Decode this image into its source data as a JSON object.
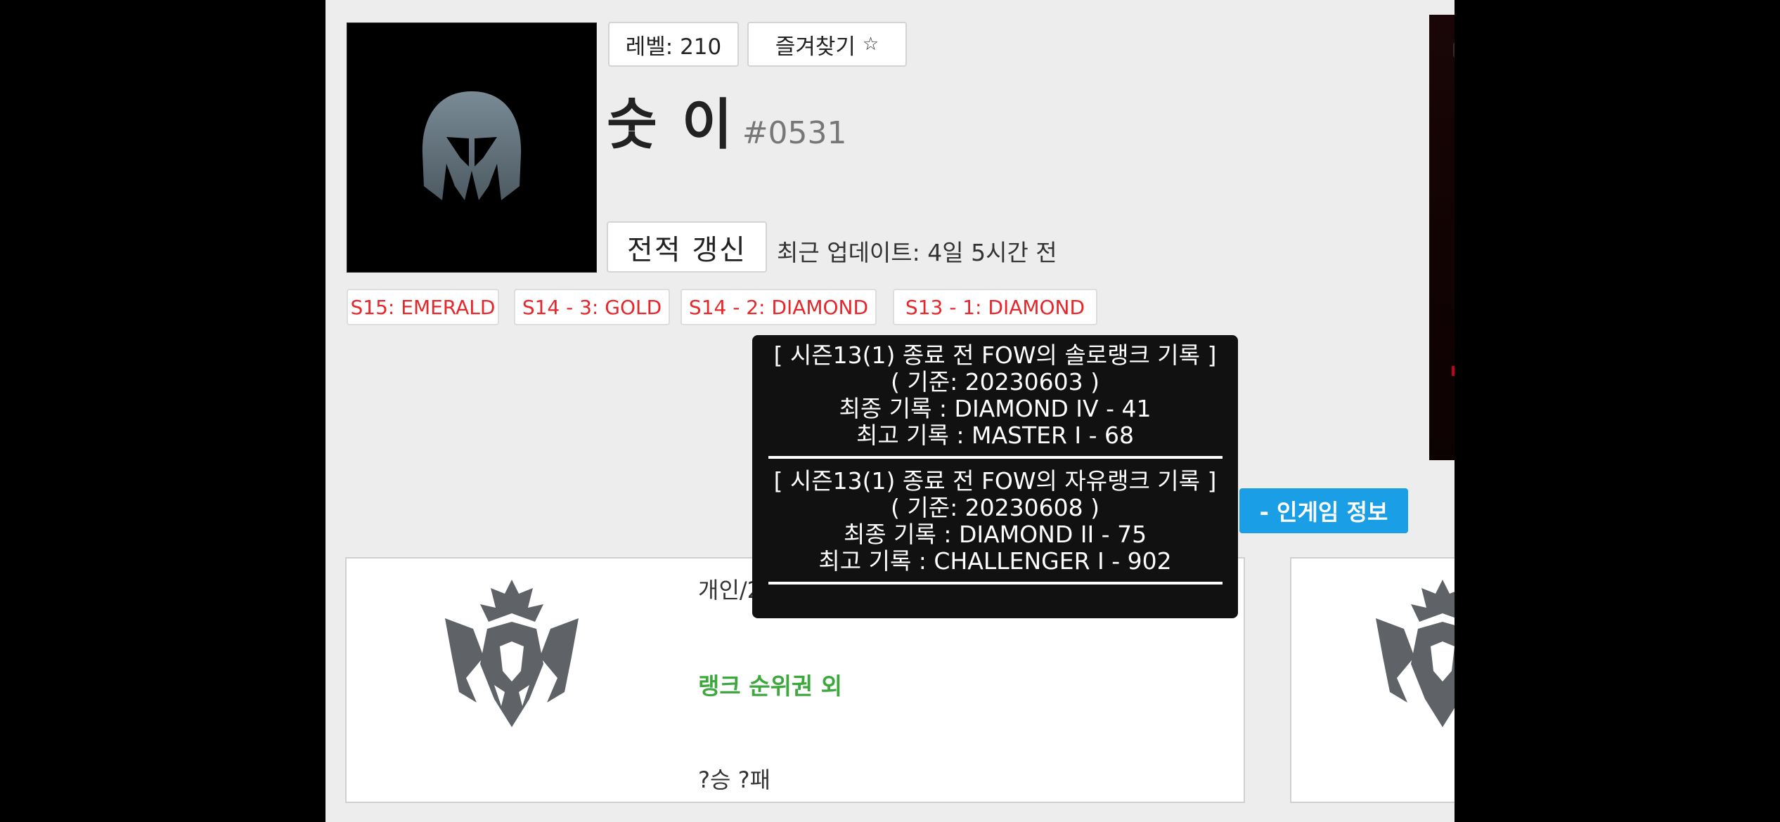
{
  "profile": {
    "level_label": "레벨: 210",
    "favorite_label": "즐겨찾기",
    "favorite_icon": "star-icon",
    "name": "숫 이",
    "tag": "#0531",
    "refresh_label": "전적 갱신",
    "last_update": "최근 업데이트: 4일 5시간 전"
  },
  "seasons": [
    {
      "label": "S15: EMERALD"
    },
    {
      "label": "S14 - 3: GOLD"
    },
    {
      "label": "S14 - 2: DIAMOND"
    },
    {
      "label": "S13 - 1: DIAMOND"
    }
  ],
  "tooltip": {
    "solo": {
      "title": "[ 시즌13(1) 종료 전 FOW의 솔로랭크 기록 ]",
      "date": "( 기준: 20230603 )",
      "final": "최종 기록 : DIAMOND IV - 41",
      "best": "최고 기록 : MASTER I - 68"
    },
    "flex": {
      "title": "[ 시즌13(1) 종료 전 FOW의 자유랭크 기록 ]",
      "date": "( 기준: 20230608 )",
      "final": "최종 기록 : DIAMOND II - 75",
      "best": "최고 기록 : CHALLENGER I - 902"
    }
  },
  "ingame_button_label": "- 인게임 정보",
  "rank_card": {
    "queue_label": "개인/2인전",
    "status": "랭크 순위권 외",
    "record": "?승 ?패"
  },
  "colors": {
    "season_badge_text": "#e8262a",
    "status_green": "#3da83d",
    "ingame_button": "#1a9ee5",
    "tooltip_bg": "#111111"
  }
}
